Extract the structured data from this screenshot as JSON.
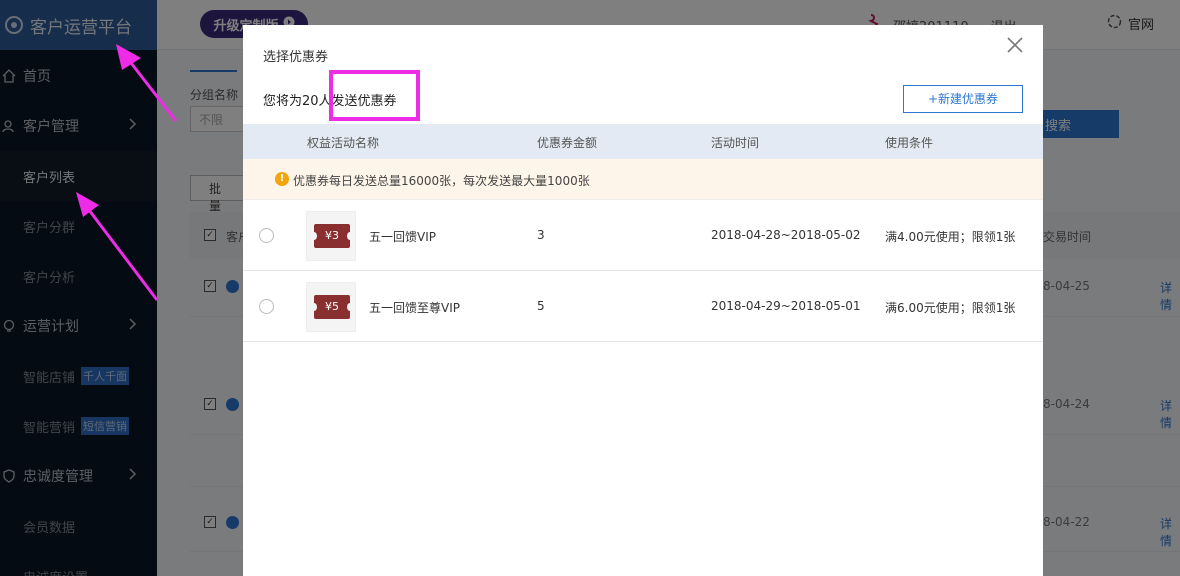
{
  "sidebar": {
    "brand_title": "客户运营平台",
    "items": [
      {
        "label": "首页"
      },
      {
        "label": "客户管理"
      },
      {
        "label": "客户列表"
      },
      {
        "label": "客户分群"
      },
      {
        "label": "客户分析"
      },
      {
        "label": "运营计划"
      },
      {
        "label": "智能店铺",
        "tag": "千人千面"
      },
      {
        "label": "智能营销",
        "tag": "短信营销"
      },
      {
        "label": "忠诚度管理"
      },
      {
        "label": "会员数据"
      },
      {
        "label": "忠诚度设置"
      }
    ]
  },
  "header": {
    "upgrade_label": "升级定制版",
    "user_name": "邵婷201110",
    "logout_label": "退出",
    "site_link": "官网"
  },
  "background": {
    "group_label": "分组名称",
    "group_placeholder": "不限",
    "search_label": "搜索",
    "batch_label": "批量设",
    "head_customer": "客户",
    "head_trade_time": "交易时间",
    "rows": [
      {
        "date": "8-04-25",
        "detail": "详情"
      },
      {
        "date": "8-04-24",
        "detail": "详情"
      },
      {
        "date": "8-04-22",
        "detail": "详情"
      }
    ]
  },
  "modal": {
    "title": "选择优惠券",
    "send_text": "您将为20人发送优惠券",
    "new_coupon_label": "+新建优惠券",
    "columns": [
      "权益活动名称",
      "优惠券金额",
      "活动时间",
      "使用条件"
    ],
    "notice": "优惠券每日发送总量16000张，每次发送最大量1000张",
    "coupons": [
      {
        "ticket": "¥3",
        "name": "五一回馈VIP",
        "amount": "3",
        "time": "2018-04-28~2018-05-02",
        "condition": "满4.00元使用；限领1张"
      },
      {
        "ticket": "¥5",
        "name": "五一回馈至尊VIP",
        "amount": "5",
        "time": "2018-04-29~2018-05-01",
        "condition": "满6.00元使用；限领1张"
      }
    ]
  },
  "colors": {
    "sidebar_bg": "#0b1726",
    "brand_bg": "#2d5c97",
    "accent": "#2e77d0",
    "highlight": "#ee2be6",
    "arrow": "#ee2be6",
    "coupon_ticket": "#8a2f2f"
  },
  "icons": [
    "logo-icon",
    "home-icon",
    "users-icon",
    "bulb-icon",
    "shield-icon",
    "chevron-right-icon",
    "close-icon",
    "warning-icon",
    "radio-icon",
    "coupon-ticket-icon"
  ]
}
